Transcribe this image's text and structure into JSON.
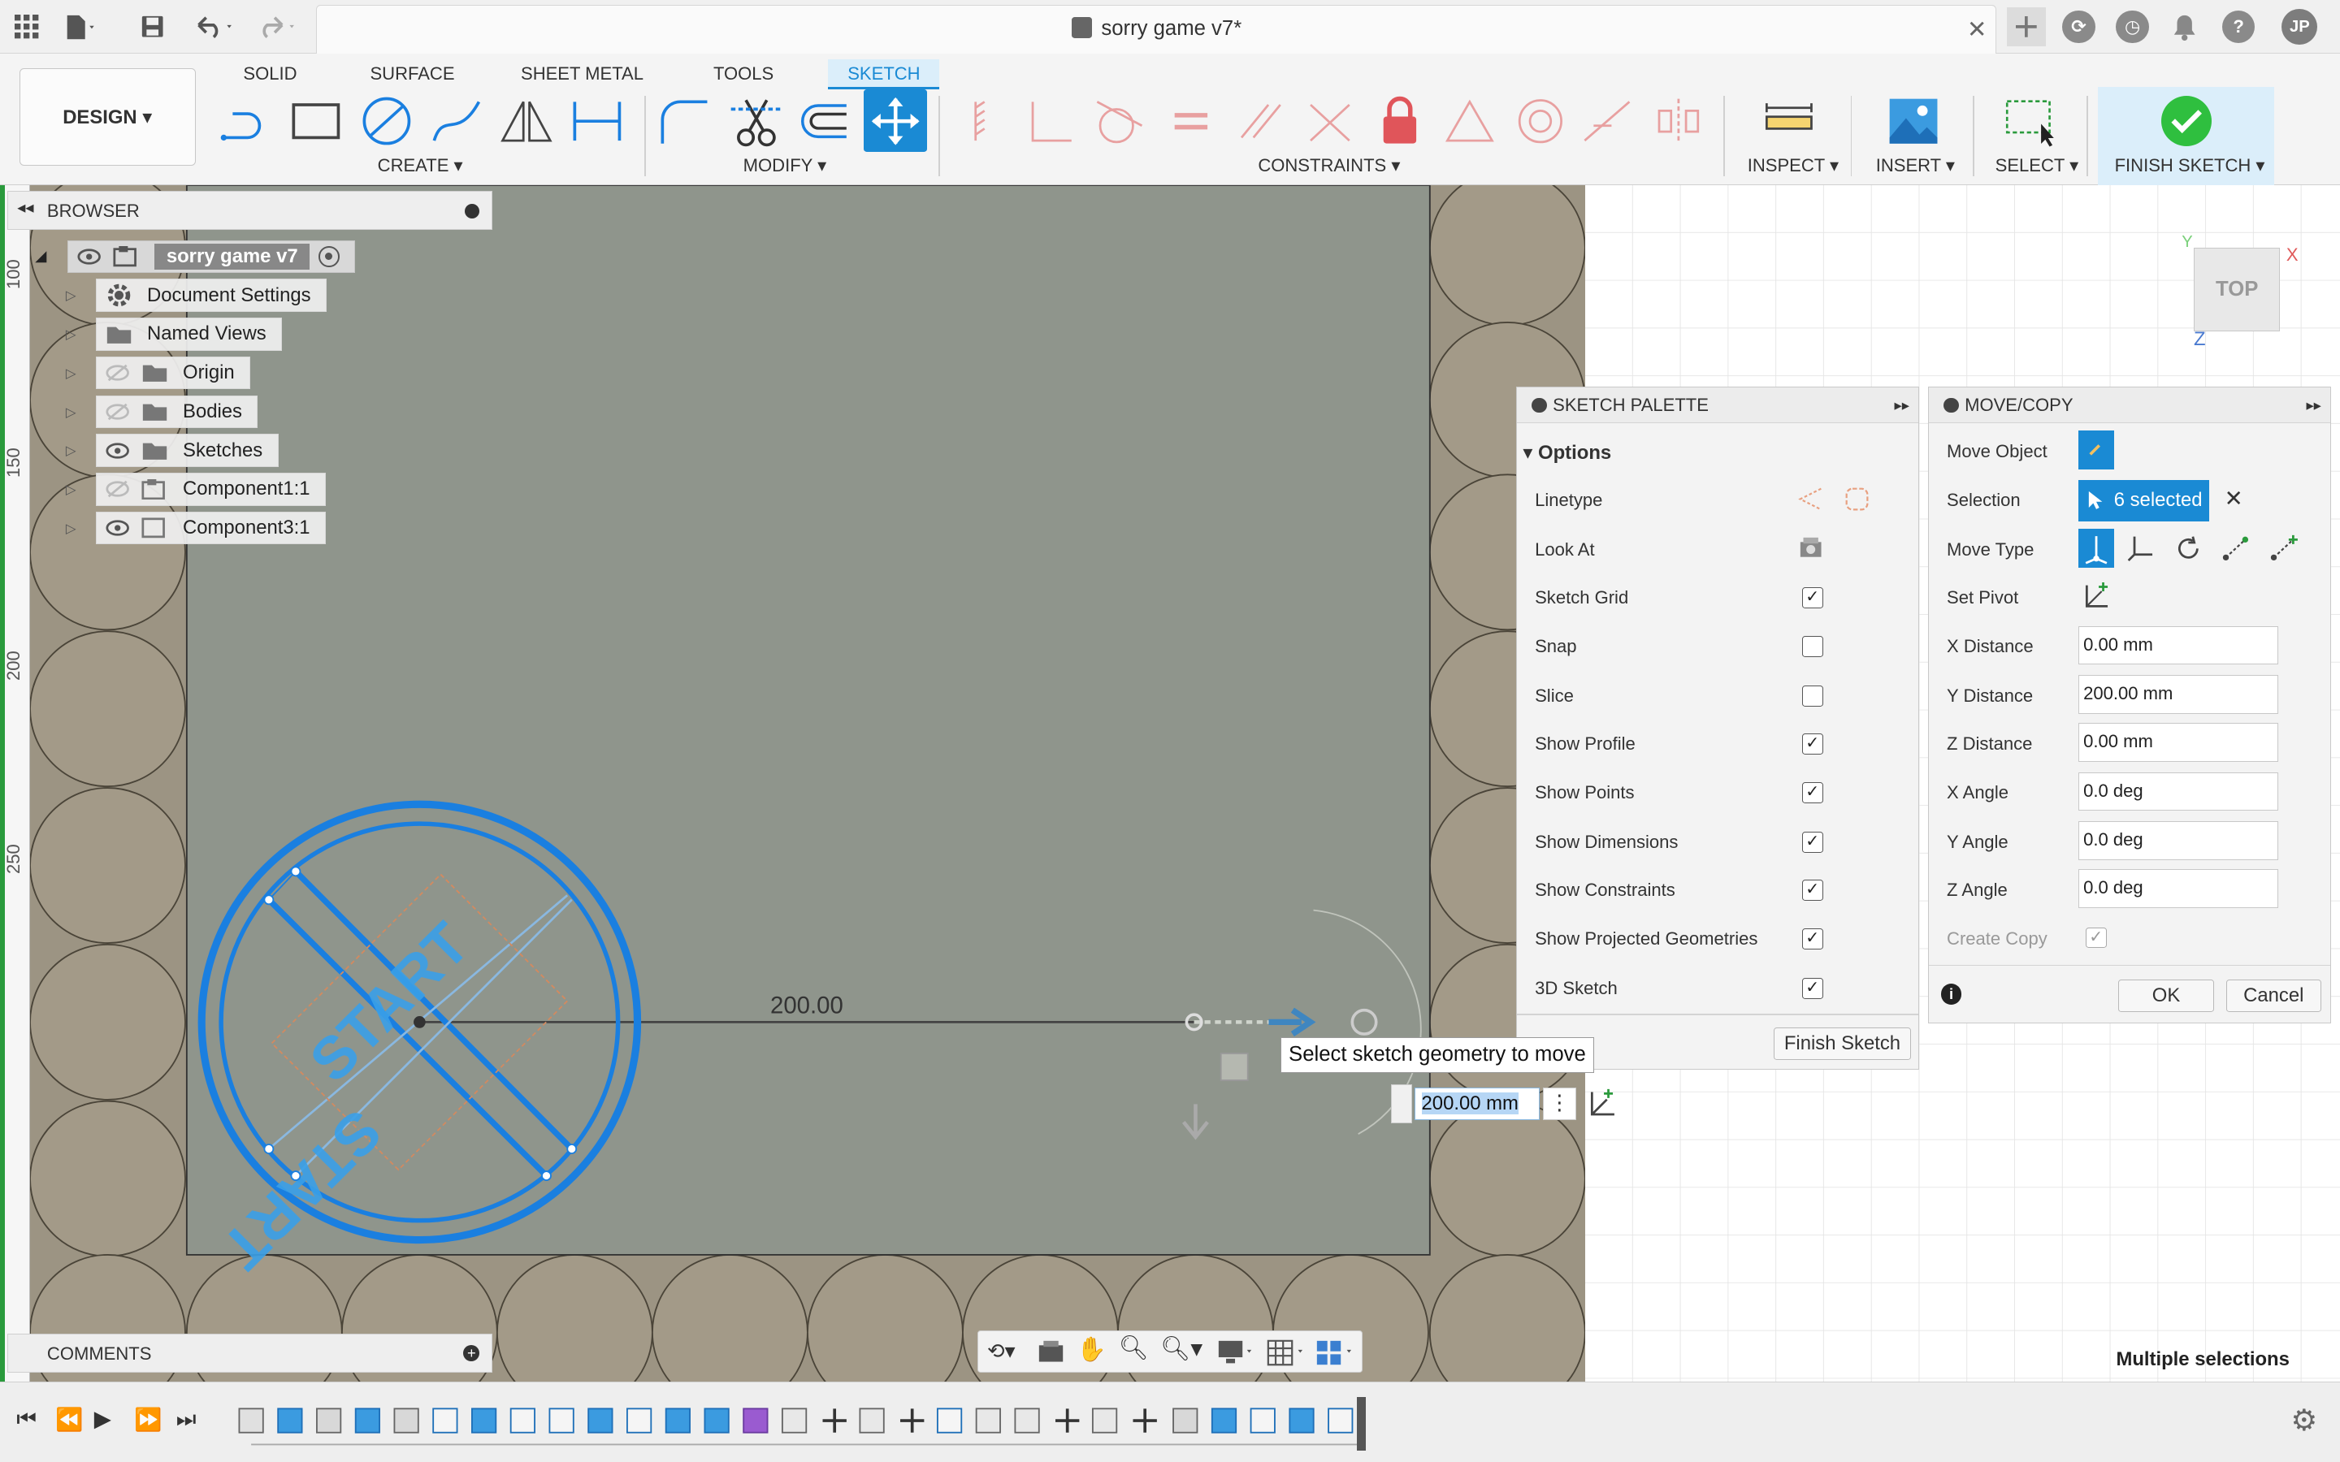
{
  "titlebar": {
    "doc_title": "sorry game v7*",
    "avatar": "JP",
    "icons": [
      "app-grid-icon",
      "file-icon",
      "save-icon",
      "undo-icon",
      "redo-icon",
      "close-icon",
      "new-tab-icon",
      "extensions-icon",
      "job-status-icon",
      "notifications-icon",
      "help-icon"
    ]
  },
  "ribbon": {
    "design_label": "DESIGN ▾",
    "tabs": [
      "SOLID",
      "SURFACE",
      "SHEET METAL",
      "TOOLS",
      "SKETCH"
    ],
    "active_tab": "SKETCH",
    "groups": {
      "create": "CREATE ▾",
      "modify": "MODIFY ▾",
      "constraints": "CONSTRAINTS ▾",
      "inspect": "INSPECT ▾",
      "insert": "INSERT ▾",
      "select": "SELECT ▾",
      "finish": "FINISH SKETCH ▾"
    },
    "accent": "#1a8ad4"
  },
  "ruler": {
    "labels": [
      "100",
      "150",
      "200",
      "250"
    ]
  },
  "browser": {
    "title": "BROWSER",
    "root": "sorry game v7",
    "items": [
      {
        "label": "Document Settings",
        "icon": "gear-icon"
      },
      {
        "label": "Named Views",
        "icon": "folder-icon"
      },
      {
        "label": "Origin",
        "icon": "folder-icon"
      },
      {
        "label": "Bodies",
        "icon": "folder-icon"
      },
      {
        "label": "Sketches",
        "icon": "folder-icon"
      },
      {
        "label": "Component1:1",
        "icon": "component-icon"
      },
      {
        "label": "Component3:1",
        "icon": "component-icon"
      }
    ]
  },
  "comments": {
    "title": "COMMENTS"
  },
  "canvas": {
    "dimension": "200.00",
    "tooltip": "Select sketch geometry to move",
    "dim_input": "200.00 mm",
    "viewcube": "TOP",
    "axes": {
      "x": "X",
      "y": "Y",
      "z": "Z"
    },
    "sketch_color": "#1a7fe0",
    "background_color": "#9c9483"
  },
  "sketch_palette": {
    "title": "SKETCH PALETTE",
    "section": "Options",
    "rows": [
      {
        "label": "Linetype",
        "kind": "icons"
      },
      {
        "label": "Look At",
        "kind": "icon"
      },
      {
        "label": "Sketch Grid",
        "kind": "check",
        "checked": "✓"
      },
      {
        "label": "Snap",
        "kind": "check",
        "checked": ""
      },
      {
        "label": "Slice",
        "kind": "check",
        "checked": ""
      },
      {
        "label": "Show Profile",
        "kind": "check",
        "checked": "✓"
      },
      {
        "label": "Show Points",
        "kind": "check",
        "checked": "✓"
      },
      {
        "label": "Show Dimensions",
        "kind": "check",
        "checked": "✓"
      },
      {
        "label": "Show Constraints",
        "kind": "check",
        "checked": "✓"
      },
      {
        "label": "Show Projected Geometries",
        "kind": "check",
        "checked": "✓"
      },
      {
        "label": "3D Sketch",
        "kind": "check",
        "checked": "✓"
      }
    ],
    "finish_button": "Finish Sketch"
  },
  "move_copy": {
    "title": "MOVE/COPY",
    "move_object_label": "Move Object",
    "selection_label": "Selection",
    "selection_value": "6 selected",
    "move_type_label": "Move Type",
    "set_pivot_label": "Set Pivot",
    "fields": [
      {
        "label": "X Distance",
        "value": "0.00 mm"
      },
      {
        "label": "Y Distance",
        "value": "200.00 mm"
      },
      {
        "label": "Z Distance",
        "value": "0.00 mm"
      },
      {
        "label": "X Angle",
        "value": "0.0 deg"
      },
      {
        "label": "Y Angle",
        "value": "0.0 deg"
      },
      {
        "label": "Z Angle",
        "value": "0.0 deg"
      }
    ],
    "create_copy_label": "Create Copy",
    "create_copy_checked": "✓",
    "ok": "OK",
    "cancel": "Cancel"
  },
  "status": {
    "text": "Multiple selections"
  }
}
